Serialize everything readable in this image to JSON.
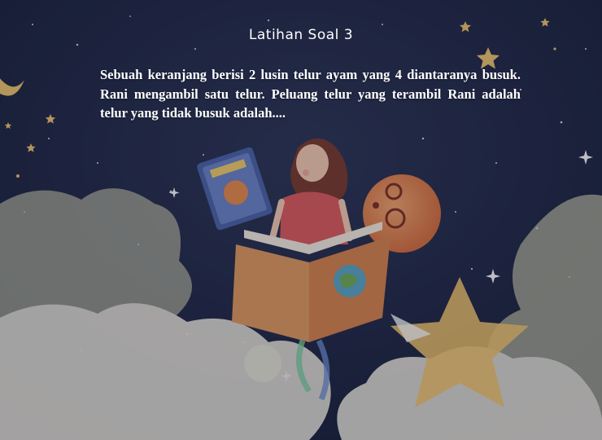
{
  "slide": {
    "title": "Latihan Soal 3",
    "question": "Sebuah keranjang berisi 2 lusin telur ayam yang 4 diantaranya busuk. Rani mengambil satu telur. Peluang telur yang terambil Rani adalah telur yang tidak busuk adalah...."
  },
  "colors": {
    "sky": "#1c2340",
    "text": "#ffffff",
    "star": "#f2c56b",
    "cloud": "#f3eee3",
    "planet": "#e9874e"
  }
}
